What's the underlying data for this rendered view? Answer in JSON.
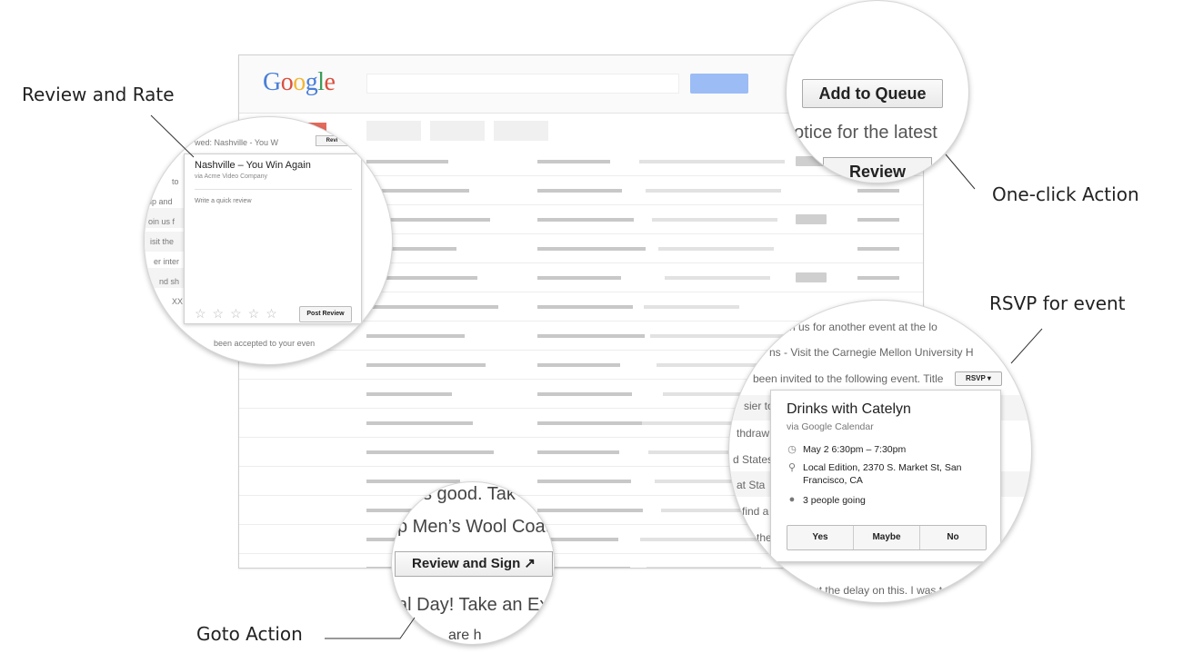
{
  "callouts": {
    "review_and_rate": "Review and Rate",
    "one_click_action": "One-click Action",
    "rsvp_for_event": "RSVP for event",
    "goto_action": "Goto Action"
  },
  "inbox": {
    "logo": "Google"
  },
  "review_card": {
    "snippet_top": "wed: Nashville - You W",
    "mini_button": "Revi",
    "title": "Nashville – You Win Again",
    "via": "via Acme Video Company",
    "placeholder": "Write a quick review",
    "stars": "☆☆☆☆☆",
    "post_button": "Post Review",
    "left_snippets": [
      "to",
      "ip and",
      "oin us f",
      "isit the",
      "er inter",
      "nd sh",
      "XX"
    ],
    "bottom_snippet": "been accepted to your even"
  },
  "one_click": {
    "button": "Add to Queue",
    "snippet": "otice for the latest",
    "second_button": "Review"
  },
  "rsvp": {
    "snippets": [
      "n us for another event at the lo",
      "ns - Visit the Carnegie Mellon University H",
      "been invited to the following event. Title"
    ],
    "chip": "RSVP ▾",
    "left_snippets": [
      "sier to",
      "thdraw",
      "d States",
      "at Sta",
      "find a",
      "the"
    ],
    "event": {
      "title": "Drinks with Catelyn",
      "via": "via Google Calendar",
      "time": "May 2 6:30pm – 7:30pm",
      "location": "Local Edition, 2370 S. Market St, San Francisco, CA",
      "going": "3 people going"
    },
    "buttons": [
      "Yes",
      "Maybe",
      "No"
    ],
    "bottom_snippets": [
      "about the delay on this. I was to",
      "in the"
    ]
  },
  "goto": {
    "snippets": [
      "s good. Tak",
      "p Men’s Wool Coat",
      "al Day! Take an Ex",
      "are h"
    ],
    "button": "Review and Sign ↗"
  }
}
